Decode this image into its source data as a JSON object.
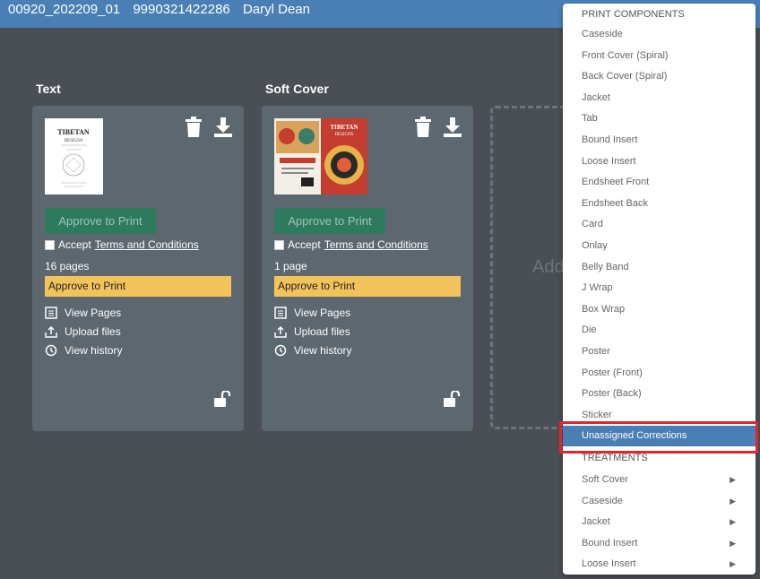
{
  "topbar": {
    "order_id": "00920_202209_01",
    "isbn": "9990321422286",
    "user": "Daryl Dean"
  },
  "sections": [
    {
      "title": "Text",
      "approve_label": "Approve to Print",
      "accept_prefix": "Accept",
      "terms_label": "Terms and Conditions",
      "pages": "16 pages",
      "status": "Approve to Print",
      "actions": [
        "View Pages",
        "Upload files",
        "View history"
      ],
      "thumb_title": "TIBETAN",
      "thumb_subtitle": "DESIGNS"
    },
    {
      "title": "Soft Cover",
      "approve_label": "Approve to Print",
      "accept_prefix": "Accept",
      "terms_label": "Terms and Conditions",
      "pages": "1 page",
      "status": "Approve to Print",
      "actions": [
        "View Pages",
        "Upload files",
        "View history"
      ],
      "thumb_title": "TIBETAN",
      "thumb_subtitle": "DESIGNS"
    }
  ],
  "add_box": {
    "label": "Add"
  },
  "menu": {
    "header_components": "PRINT COMPONENTS",
    "components": [
      "Caseside",
      "Front Cover (Spiral)",
      "Back Cover (Spiral)",
      "Jacket",
      "Tab",
      "Bound Insert",
      "Loose Insert",
      "Endsheet Front",
      "Endsheet Back",
      "Card",
      "Onlay",
      "Belly Band",
      "J Wrap",
      "Box Wrap",
      "Die",
      "Poster",
      "Poster (Front)",
      "Poster (Back)",
      "Sticker",
      "Unassigned Corrections"
    ],
    "active_item": "Unassigned Corrections",
    "header_treatments": "TREATMENTS",
    "treatments": [
      "Soft Cover",
      "Caseside",
      "Jacket",
      "Bound Insert",
      "Loose Insert"
    ]
  },
  "colors": {
    "topbar": "#4a7fb5",
    "approve_button": "#2e7a5f",
    "status": "#f3c35b",
    "highlight": "#e0252b"
  }
}
